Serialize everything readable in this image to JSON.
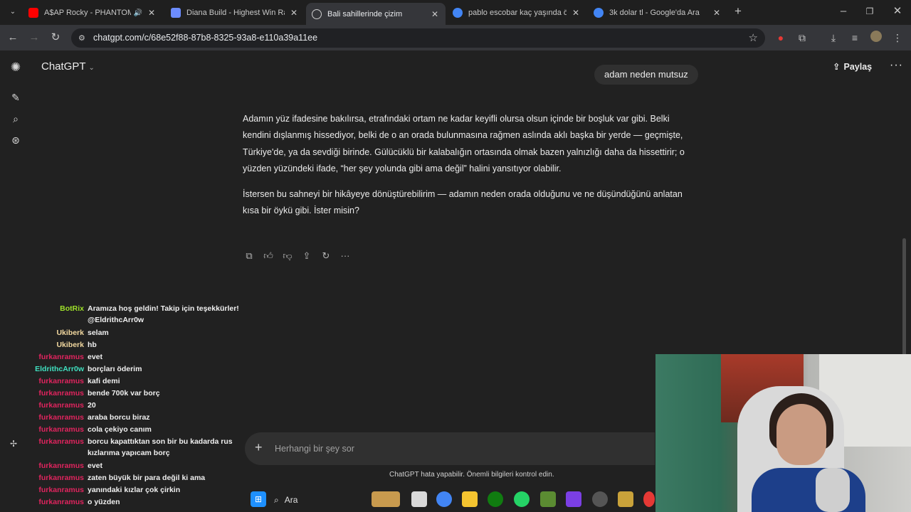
{
  "browser": {
    "tabs": [
      {
        "title": "A$AP Rocky - PHANTOM (I",
        "icon_color": "#ff0000",
        "sound": true,
        "active": false
      },
      {
        "title": "Diana Build - Highest Win Rate",
        "icon_color": "#6c8cff",
        "active": false
      },
      {
        "title": "Bali sahillerinde çizim",
        "icon_color": "#d0d0d0",
        "active": true
      },
      {
        "title": "pablo escobar kaç yaşında öldü",
        "icon_color": "#4285f4",
        "active": false
      },
      {
        "title": "3k dolar tl - Google'da Ara",
        "icon_color": "#4285f4",
        "active": false
      }
    ],
    "url": "chatgpt.com/c/68e52f88-87b8-8325-93a8-e110a39a11ee"
  },
  "app": {
    "model_name": "ChatGPT",
    "share_label": "Paylaş"
  },
  "conversation": {
    "user_message": "adam neden mutsuz",
    "assistant_paragraphs": [
      "Adamın yüz ifadesine bakılırsa, etrafındaki ortam ne kadar keyifli olursa olsun içinde bir boşluk var gibi. Belki kendini dışlanmış hissediyor, belki de o an orada bulunmasına rağmen aslında aklı başka bir yerde — geçmişte, Türkiye'de, ya da sevdiği birinde. Gülücüklü bir kalabalığın ortasında olmak bazen yalnızlığı daha da hissettirir; o yüzden yüzündeki ifade, “her şey yolunda gibi ama değil” halini yansıtıyor olabilir.",
      "İstersen bu sahneyi bir hikâyeye dönüştürebilirim — adamın neden orada olduğunu ve ne düşündüğünü anlatan kısa bir öykü gibi. İster misin?"
    ]
  },
  "composer": {
    "placeholder": "Herhangi bir şey sor",
    "disclaimer": "ChatGPT hata yapabilir. Önemli bilgileri kontrol edin."
  },
  "stream_chat": [
    {
      "user": "BotRix",
      "color": "#9ee02a",
      "text": "Aramıza hoş geldin! Takip için teşekkürler! @EldrithcArr0w"
    },
    {
      "user": "Ukiberk",
      "color": "#f3d9a0",
      "text": "selam"
    },
    {
      "user": "Ukiberk",
      "color": "#f3d9a0",
      "text": "hb"
    },
    {
      "user": "furkanramus",
      "color": "#e0245e",
      "text": "evet"
    },
    {
      "user": "EldrithcArr0w",
      "color": "#40e0c0",
      "text": "borçları öderim"
    },
    {
      "user": "furkanramus",
      "color": "#e0245e",
      "text": "kafi demi"
    },
    {
      "user": "furkanramus",
      "color": "#e0245e",
      "text": "bende 700k var borç"
    },
    {
      "user": "furkanramus",
      "color": "#e0245e",
      "text": "20"
    },
    {
      "user": "furkanramus",
      "color": "#e0245e",
      "text": "araba borcu biraz"
    },
    {
      "user": "furkanramus",
      "color": "#e0245e",
      "text": "cola çekiyo canım"
    },
    {
      "user": "furkanramus",
      "color": "#e0245e",
      "text": "borcu kapattıktan son bir bu kadarda rus kızlarıma yapıcam borç"
    },
    {
      "user": "furkanramus",
      "color": "#e0245e",
      "text": "evet"
    },
    {
      "user": "furkanramus",
      "color": "#e0245e",
      "text": "zaten büyük bir para değil ki ama"
    },
    {
      "user": "furkanramus",
      "color": "#e0245e",
      "text": "yanındaki kızlar çok çirkin"
    },
    {
      "user": "furkanramus",
      "color": "#e0245e",
      "text": "o yüzden"
    }
  ],
  "taskbar": {
    "search_label": "Ara"
  }
}
